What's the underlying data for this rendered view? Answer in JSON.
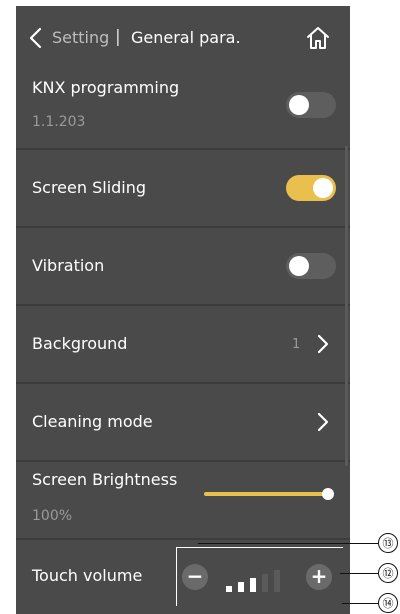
{
  "header": {
    "breadcrumb_parent": "Setting",
    "separator": "|",
    "title": "General para."
  },
  "rows": {
    "knx": {
      "label": "KNX programming",
      "address": "1.1.203",
      "enabled": false
    },
    "screen_sliding": {
      "label": "Screen Sliding",
      "enabled": true
    },
    "vibration": {
      "label": "Vibration",
      "enabled": false
    },
    "background": {
      "label": "Background",
      "value": "1"
    },
    "cleaning": {
      "label": "Cleaning mode"
    },
    "brightness": {
      "label": "Screen Brightness",
      "value_text": "100%",
      "level": 1.0
    },
    "touch_volume": {
      "label": "Touch volume",
      "level": 3,
      "max_level": 5,
      "minus": "−",
      "plus": "+"
    }
  },
  "callouts": [
    "⑬",
    "⑫",
    "⑭"
  ],
  "colors": {
    "accent": "#e9c04e",
    "panel": "#4a4a4a",
    "toggle_off": "#5e5e5e"
  }
}
